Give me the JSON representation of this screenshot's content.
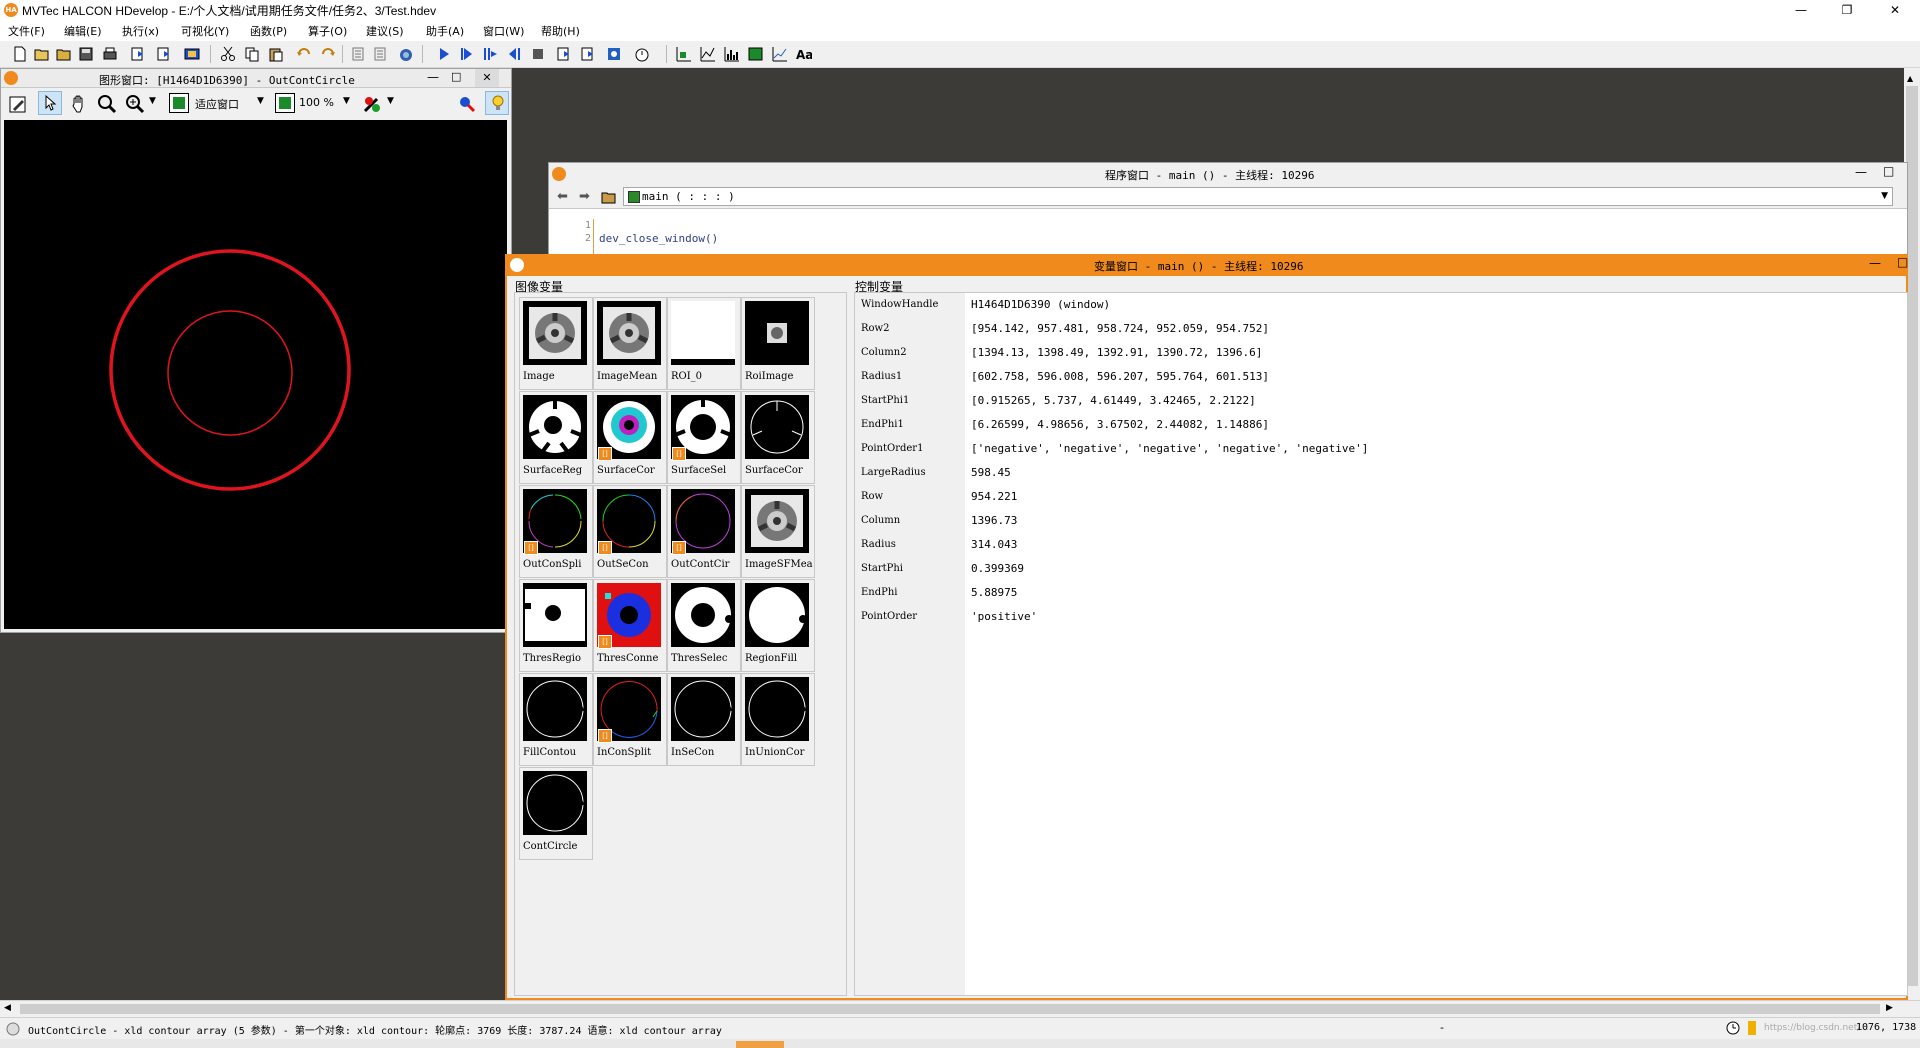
{
  "app": {
    "title": "MVTec HALCON HDevelop - E:/个人文档/试用期任务文件/任务2、3/Test.hdev",
    "logo": "HA",
    "minimize": "—",
    "maximize": "❐",
    "close": "✕"
  },
  "menu": [
    "文件(F)",
    "编辑(E)",
    "执行(x)",
    "可视化(Y)",
    "函数(P)",
    "算子(O)",
    "建议(S)",
    "助手(A)",
    "窗口(W)",
    "帮助(H)"
  ],
  "graphics_window": {
    "title": "图形窗口: [H1464D1D6390] - OutContCircle",
    "fit_label": "适应窗口",
    "zoom_value": "100 %",
    "colors": {
      "circle": "#e0141e",
      "background": "#000000"
    }
  },
  "program_window": {
    "title": "程序窗口 - main () - 主线程: 10296",
    "procedure": "main ( : : : )",
    "line_numbers": [
      "1",
      "2"
    ],
    "code_lines": [
      "",
      "dev_close_window()"
    ]
  },
  "variable_window": {
    "title": "变量窗口 - main () - 主线程: 10296",
    "image_section_label": "图像变量",
    "control_section_label": "控制变量",
    "image_vars": [
      {
        "label": "Image",
        "array": false,
        "kind": "gear"
      },
      {
        "label": "ImageMean",
        "array": false,
        "kind": "gear"
      },
      {
        "label": "ROI_0",
        "array": false,
        "kind": "white"
      },
      {
        "label": "RoiImage",
        "array": false,
        "kind": "roi"
      },
      {
        "label": "SurfaceReg",
        "array": false,
        "kind": "white-gear"
      },
      {
        "label": "SurfaceCor",
        "array": true,
        "kind": "cyan-gear"
      },
      {
        "label": "SurfaceSel",
        "array": true,
        "kind": "white-ring"
      },
      {
        "label": "SurfaceCor",
        "array": false,
        "kind": "outline-gear"
      },
      {
        "label": "OutConSpli",
        "array": true,
        "kind": "multi-outline"
      },
      {
        "label": "OutSeCon",
        "array": true,
        "kind": "multi-circle"
      },
      {
        "label": "OutContCir",
        "array": true,
        "kind": "purple-circle"
      },
      {
        "label": "ImageSFMea",
        "array": false,
        "kind": "gear"
      },
      {
        "label": "ThresRegio",
        "array": false,
        "kind": "thres-white"
      },
      {
        "label": "ThresConne",
        "array": true,
        "kind": "thres-red"
      },
      {
        "label": "ThresSelec",
        "array": false,
        "kind": "white-ring2"
      },
      {
        "label": "RegionFill",
        "array": false,
        "kind": "white-disk"
      },
      {
        "label": "FillContou",
        "array": false,
        "kind": "circle-outline"
      },
      {
        "label": "InConSplit",
        "array": true,
        "kind": "red-circle"
      },
      {
        "label": "InSeCon",
        "array": false,
        "kind": "circle-outline"
      },
      {
        "label": "InUnionCor",
        "array": false,
        "kind": "circle-outline"
      },
      {
        "label": "ContCircle",
        "array": false,
        "kind": "circle-outline"
      }
    ],
    "control_vars": [
      {
        "name": "WindowHandle",
        "value": "H1464D1D6390 (window)"
      },
      {
        "name": "Row2",
        "value": "[954.142, 957.481, 958.724, 952.059, 954.752]"
      },
      {
        "name": "Column2",
        "value": "[1394.13, 1398.49, 1392.91, 1390.72, 1396.6]"
      },
      {
        "name": "Radius1",
        "value": "[602.758, 596.008, 596.207, 595.764, 601.513]"
      },
      {
        "name": "StartPhi1",
        "value": "[0.915265, 5.737, 4.61449, 3.42465, 2.2122]"
      },
      {
        "name": "EndPhi1",
        "value": "[6.26599, 4.98656, 3.67502, 2.44082, 1.14886]"
      },
      {
        "name": "PointOrder1",
        "value": "['negative', 'negative', 'negative', 'negative', 'negative']"
      },
      {
        "name": "LargeRadius",
        "value": "598.45"
      },
      {
        "name": "Row",
        "value": "954.221"
      },
      {
        "name": "Column",
        "value": "1396.73"
      },
      {
        "name": "Radius",
        "value": "314.043"
      },
      {
        "name": "StartPhi",
        "value": "0.399369"
      },
      {
        "name": "EndPhi",
        "value": "5.88975"
      },
      {
        "name": "PointOrder",
        "value": "'positive'"
      }
    ]
  },
  "status": {
    "text": "OutContCircle - xld contour array (5 参数) - 第一个对象: xld contour: 轮廓点: 3769 长度: 3787.24 语意: xld contour array",
    "dash": "-",
    "coords": "1076, 1738",
    "watermark": "https://blog.csdn.net/..."
  }
}
